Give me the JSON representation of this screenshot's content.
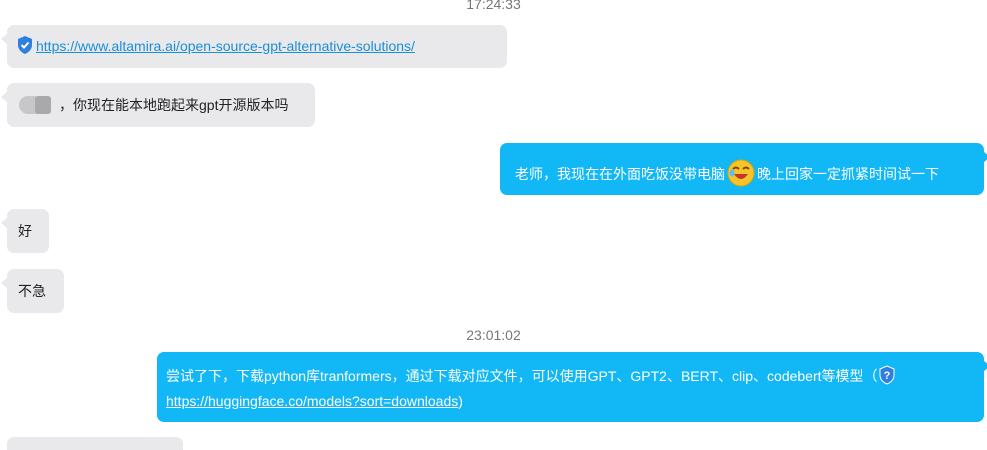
{
  "timestamps": {
    "t1": "17:24:33",
    "t2": "23:01:02"
  },
  "messages": {
    "m1": {
      "link": "https://www.altamira.ai/open-source-gpt-alternative-solutions/"
    },
    "m2": {
      "text": "，你现在能本地跑起来gpt开源版本吗"
    },
    "m3": {
      "text_before": "老师，我现在在外面吃饭没带电脑",
      "text_after": "晚上回家一定抓紧时间试一下"
    },
    "m4": {
      "text": "好"
    },
    "m5": {
      "text": "不急"
    },
    "m6": {
      "text": "尝试了下，下载python库tranformers，通过下载对应文件，可以使用GPT、GPT2、BERT、clip、codebert等模型（",
      "link": "https://huggingface.co/models?sort=downloads",
      "tail": ")"
    }
  },
  "colors": {
    "outgoing": "#12b7f5",
    "incoming": "#e9e9eb",
    "link": "#1a8fd6"
  }
}
